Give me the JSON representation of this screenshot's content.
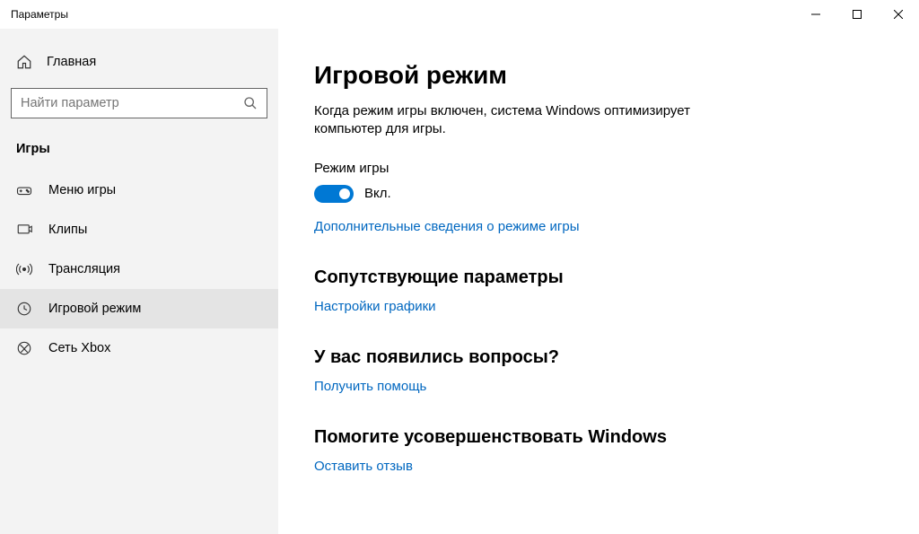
{
  "window": {
    "title": "Параметры"
  },
  "sidebar": {
    "home_label": "Главная",
    "search_placeholder": "Найти параметр",
    "category": "Игры",
    "items": [
      {
        "label": "Меню игры"
      },
      {
        "label": "Клипы"
      },
      {
        "label": "Трансляция"
      },
      {
        "label": "Игровой режим"
      },
      {
        "label": "Сеть Xbox"
      }
    ]
  },
  "main": {
    "title": "Игровой режим",
    "description": "Когда режим игры включен, система Windows оптимизирует компьютер для игры.",
    "toggle_label": "Режим игры",
    "toggle_state": "Вкл.",
    "learn_more_link": "Дополнительные сведения о режиме игры",
    "sections": {
      "related": {
        "title": "Сопутствующие параметры",
        "link": "Настройки графики"
      },
      "questions": {
        "title": "У вас появились вопросы?",
        "link": "Получить помощь"
      },
      "feedback": {
        "title": "Помогите усовершенствовать Windows",
        "link": "Оставить отзыв"
      }
    }
  }
}
